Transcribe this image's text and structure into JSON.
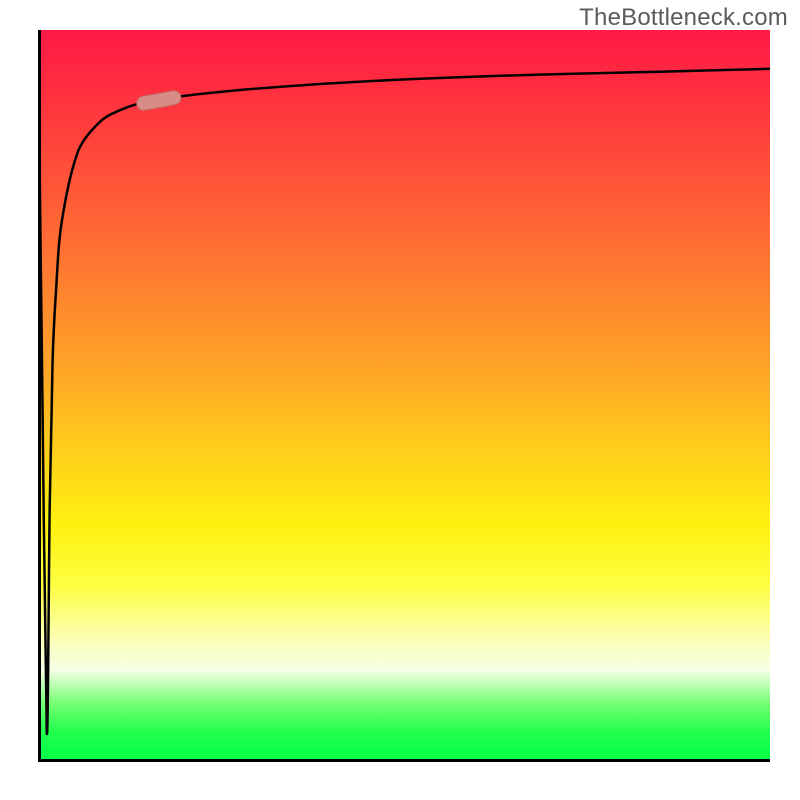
{
  "watermark": "TheBottleneck.com",
  "colors": {
    "axis": "#000000",
    "curve": "#000000",
    "highlight_fill": "#d78d86",
    "highlight_stroke": "#bb6e66",
    "gradient_top": "#ff1946",
    "gradient_mid": "#fff210",
    "gradient_bottom": "#00ff45"
  },
  "chart_data": {
    "type": "line",
    "title": "",
    "xlabel": "",
    "ylabel": "",
    "xlim": [
      0,
      100
    ],
    "ylim": [
      0,
      100
    ],
    "grid": false,
    "legend": false,
    "series": [
      {
        "name": "bottleneck-curve",
        "x": [
          0,
          0.6,
          1.2,
          1.6,
          2.0,
          2.5,
          3.0,
          4.0,
          5.0,
          6.0,
          8.0,
          10.0,
          14.0,
          20.0,
          30.0,
          45.0,
          65.0,
          85.0,
          100.0
        ],
        "y": [
          100,
          50,
          4,
          35,
          55,
          65,
          72,
          78,
          82,
          84.5,
          87,
          88.5,
          90,
          91,
          92,
          93,
          93.8,
          94.3,
          94.7
        ]
      }
    ],
    "highlight_segment": {
      "x_start": 13.5,
      "x_end": 19.5,
      "description": "pink pill marker on curve"
    },
    "background_gradient": {
      "direction": "vertical",
      "stops": [
        {
          "pos": 0.0,
          "color": "#ff1946"
        },
        {
          "pos": 0.5,
          "color": "#ffd01a"
        },
        {
          "pos": 0.72,
          "color": "#fff210"
        },
        {
          "pos": 0.88,
          "color": "#f3ffe6"
        },
        {
          "pos": 1.0,
          "color": "#00ff45"
        }
      ]
    },
    "axis_ticks": {
      "x": [],
      "y": []
    }
  }
}
